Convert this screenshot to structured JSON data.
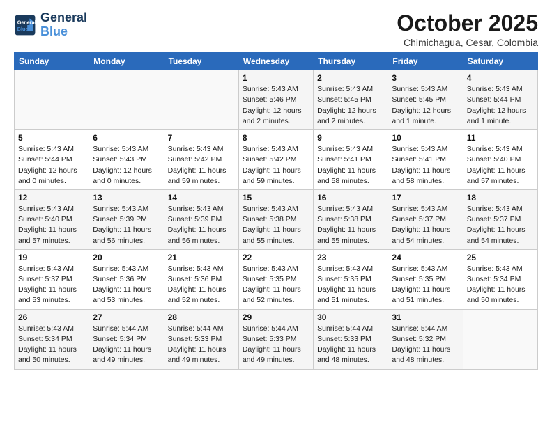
{
  "logo": {
    "line1": "General",
    "line2": "Blue"
  },
  "title": "October 2025",
  "subtitle": "Chimichagua, Cesar, Colombia",
  "weekdays": [
    "Sunday",
    "Monday",
    "Tuesday",
    "Wednesday",
    "Thursday",
    "Friday",
    "Saturday"
  ],
  "weeks": [
    [
      {
        "day": "",
        "info": ""
      },
      {
        "day": "",
        "info": ""
      },
      {
        "day": "",
        "info": ""
      },
      {
        "day": "1",
        "info": "Sunrise: 5:43 AM\nSunset: 5:46 PM\nDaylight: 12 hours\nand 2 minutes."
      },
      {
        "day": "2",
        "info": "Sunrise: 5:43 AM\nSunset: 5:45 PM\nDaylight: 12 hours\nand 2 minutes."
      },
      {
        "day": "3",
        "info": "Sunrise: 5:43 AM\nSunset: 5:45 PM\nDaylight: 12 hours\nand 1 minute."
      },
      {
        "day": "4",
        "info": "Sunrise: 5:43 AM\nSunset: 5:44 PM\nDaylight: 12 hours\nand 1 minute."
      }
    ],
    [
      {
        "day": "5",
        "info": "Sunrise: 5:43 AM\nSunset: 5:44 PM\nDaylight: 12 hours\nand 0 minutes."
      },
      {
        "day": "6",
        "info": "Sunrise: 5:43 AM\nSunset: 5:43 PM\nDaylight: 12 hours\nand 0 minutes."
      },
      {
        "day": "7",
        "info": "Sunrise: 5:43 AM\nSunset: 5:42 PM\nDaylight: 11 hours\nand 59 minutes."
      },
      {
        "day": "8",
        "info": "Sunrise: 5:43 AM\nSunset: 5:42 PM\nDaylight: 11 hours\nand 59 minutes."
      },
      {
        "day": "9",
        "info": "Sunrise: 5:43 AM\nSunset: 5:41 PM\nDaylight: 11 hours\nand 58 minutes."
      },
      {
        "day": "10",
        "info": "Sunrise: 5:43 AM\nSunset: 5:41 PM\nDaylight: 11 hours\nand 58 minutes."
      },
      {
        "day": "11",
        "info": "Sunrise: 5:43 AM\nSunset: 5:40 PM\nDaylight: 11 hours\nand 57 minutes."
      }
    ],
    [
      {
        "day": "12",
        "info": "Sunrise: 5:43 AM\nSunset: 5:40 PM\nDaylight: 11 hours\nand 57 minutes."
      },
      {
        "day": "13",
        "info": "Sunrise: 5:43 AM\nSunset: 5:39 PM\nDaylight: 11 hours\nand 56 minutes."
      },
      {
        "day": "14",
        "info": "Sunrise: 5:43 AM\nSunset: 5:39 PM\nDaylight: 11 hours\nand 56 minutes."
      },
      {
        "day": "15",
        "info": "Sunrise: 5:43 AM\nSunset: 5:38 PM\nDaylight: 11 hours\nand 55 minutes."
      },
      {
        "day": "16",
        "info": "Sunrise: 5:43 AM\nSunset: 5:38 PM\nDaylight: 11 hours\nand 55 minutes."
      },
      {
        "day": "17",
        "info": "Sunrise: 5:43 AM\nSunset: 5:37 PM\nDaylight: 11 hours\nand 54 minutes."
      },
      {
        "day": "18",
        "info": "Sunrise: 5:43 AM\nSunset: 5:37 PM\nDaylight: 11 hours\nand 54 minutes."
      }
    ],
    [
      {
        "day": "19",
        "info": "Sunrise: 5:43 AM\nSunset: 5:37 PM\nDaylight: 11 hours\nand 53 minutes."
      },
      {
        "day": "20",
        "info": "Sunrise: 5:43 AM\nSunset: 5:36 PM\nDaylight: 11 hours\nand 53 minutes."
      },
      {
        "day": "21",
        "info": "Sunrise: 5:43 AM\nSunset: 5:36 PM\nDaylight: 11 hours\nand 52 minutes."
      },
      {
        "day": "22",
        "info": "Sunrise: 5:43 AM\nSunset: 5:35 PM\nDaylight: 11 hours\nand 52 minutes."
      },
      {
        "day": "23",
        "info": "Sunrise: 5:43 AM\nSunset: 5:35 PM\nDaylight: 11 hours\nand 51 minutes."
      },
      {
        "day": "24",
        "info": "Sunrise: 5:43 AM\nSunset: 5:35 PM\nDaylight: 11 hours\nand 51 minutes."
      },
      {
        "day": "25",
        "info": "Sunrise: 5:43 AM\nSunset: 5:34 PM\nDaylight: 11 hours\nand 50 minutes."
      }
    ],
    [
      {
        "day": "26",
        "info": "Sunrise: 5:43 AM\nSunset: 5:34 PM\nDaylight: 11 hours\nand 50 minutes."
      },
      {
        "day": "27",
        "info": "Sunrise: 5:44 AM\nSunset: 5:34 PM\nDaylight: 11 hours\nand 49 minutes."
      },
      {
        "day": "28",
        "info": "Sunrise: 5:44 AM\nSunset: 5:33 PM\nDaylight: 11 hours\nand 49 minutes."
      },
      {
        "day": "29",
        "info": "Sunrise: 5:44 AM\nSunset: 5:33 PM\nDaylight: 11 hours\nand 49 minutes."
      },
      {
        "day": "30",
        "info": "Sunrise: 5:44 AM\nSunset: 5:33 PM\nDaylight: 11 hours\nand 48 minutes."
      },
      {
        "day": "31",
        "info": "Sunrise: 5:44 AM\nSunset: 5:32 PM\nDaylight: 11 hours\nand 48 minutes."
      },
      {
        "day": "",
        "info": ""
      }
    ]
  ]
}
